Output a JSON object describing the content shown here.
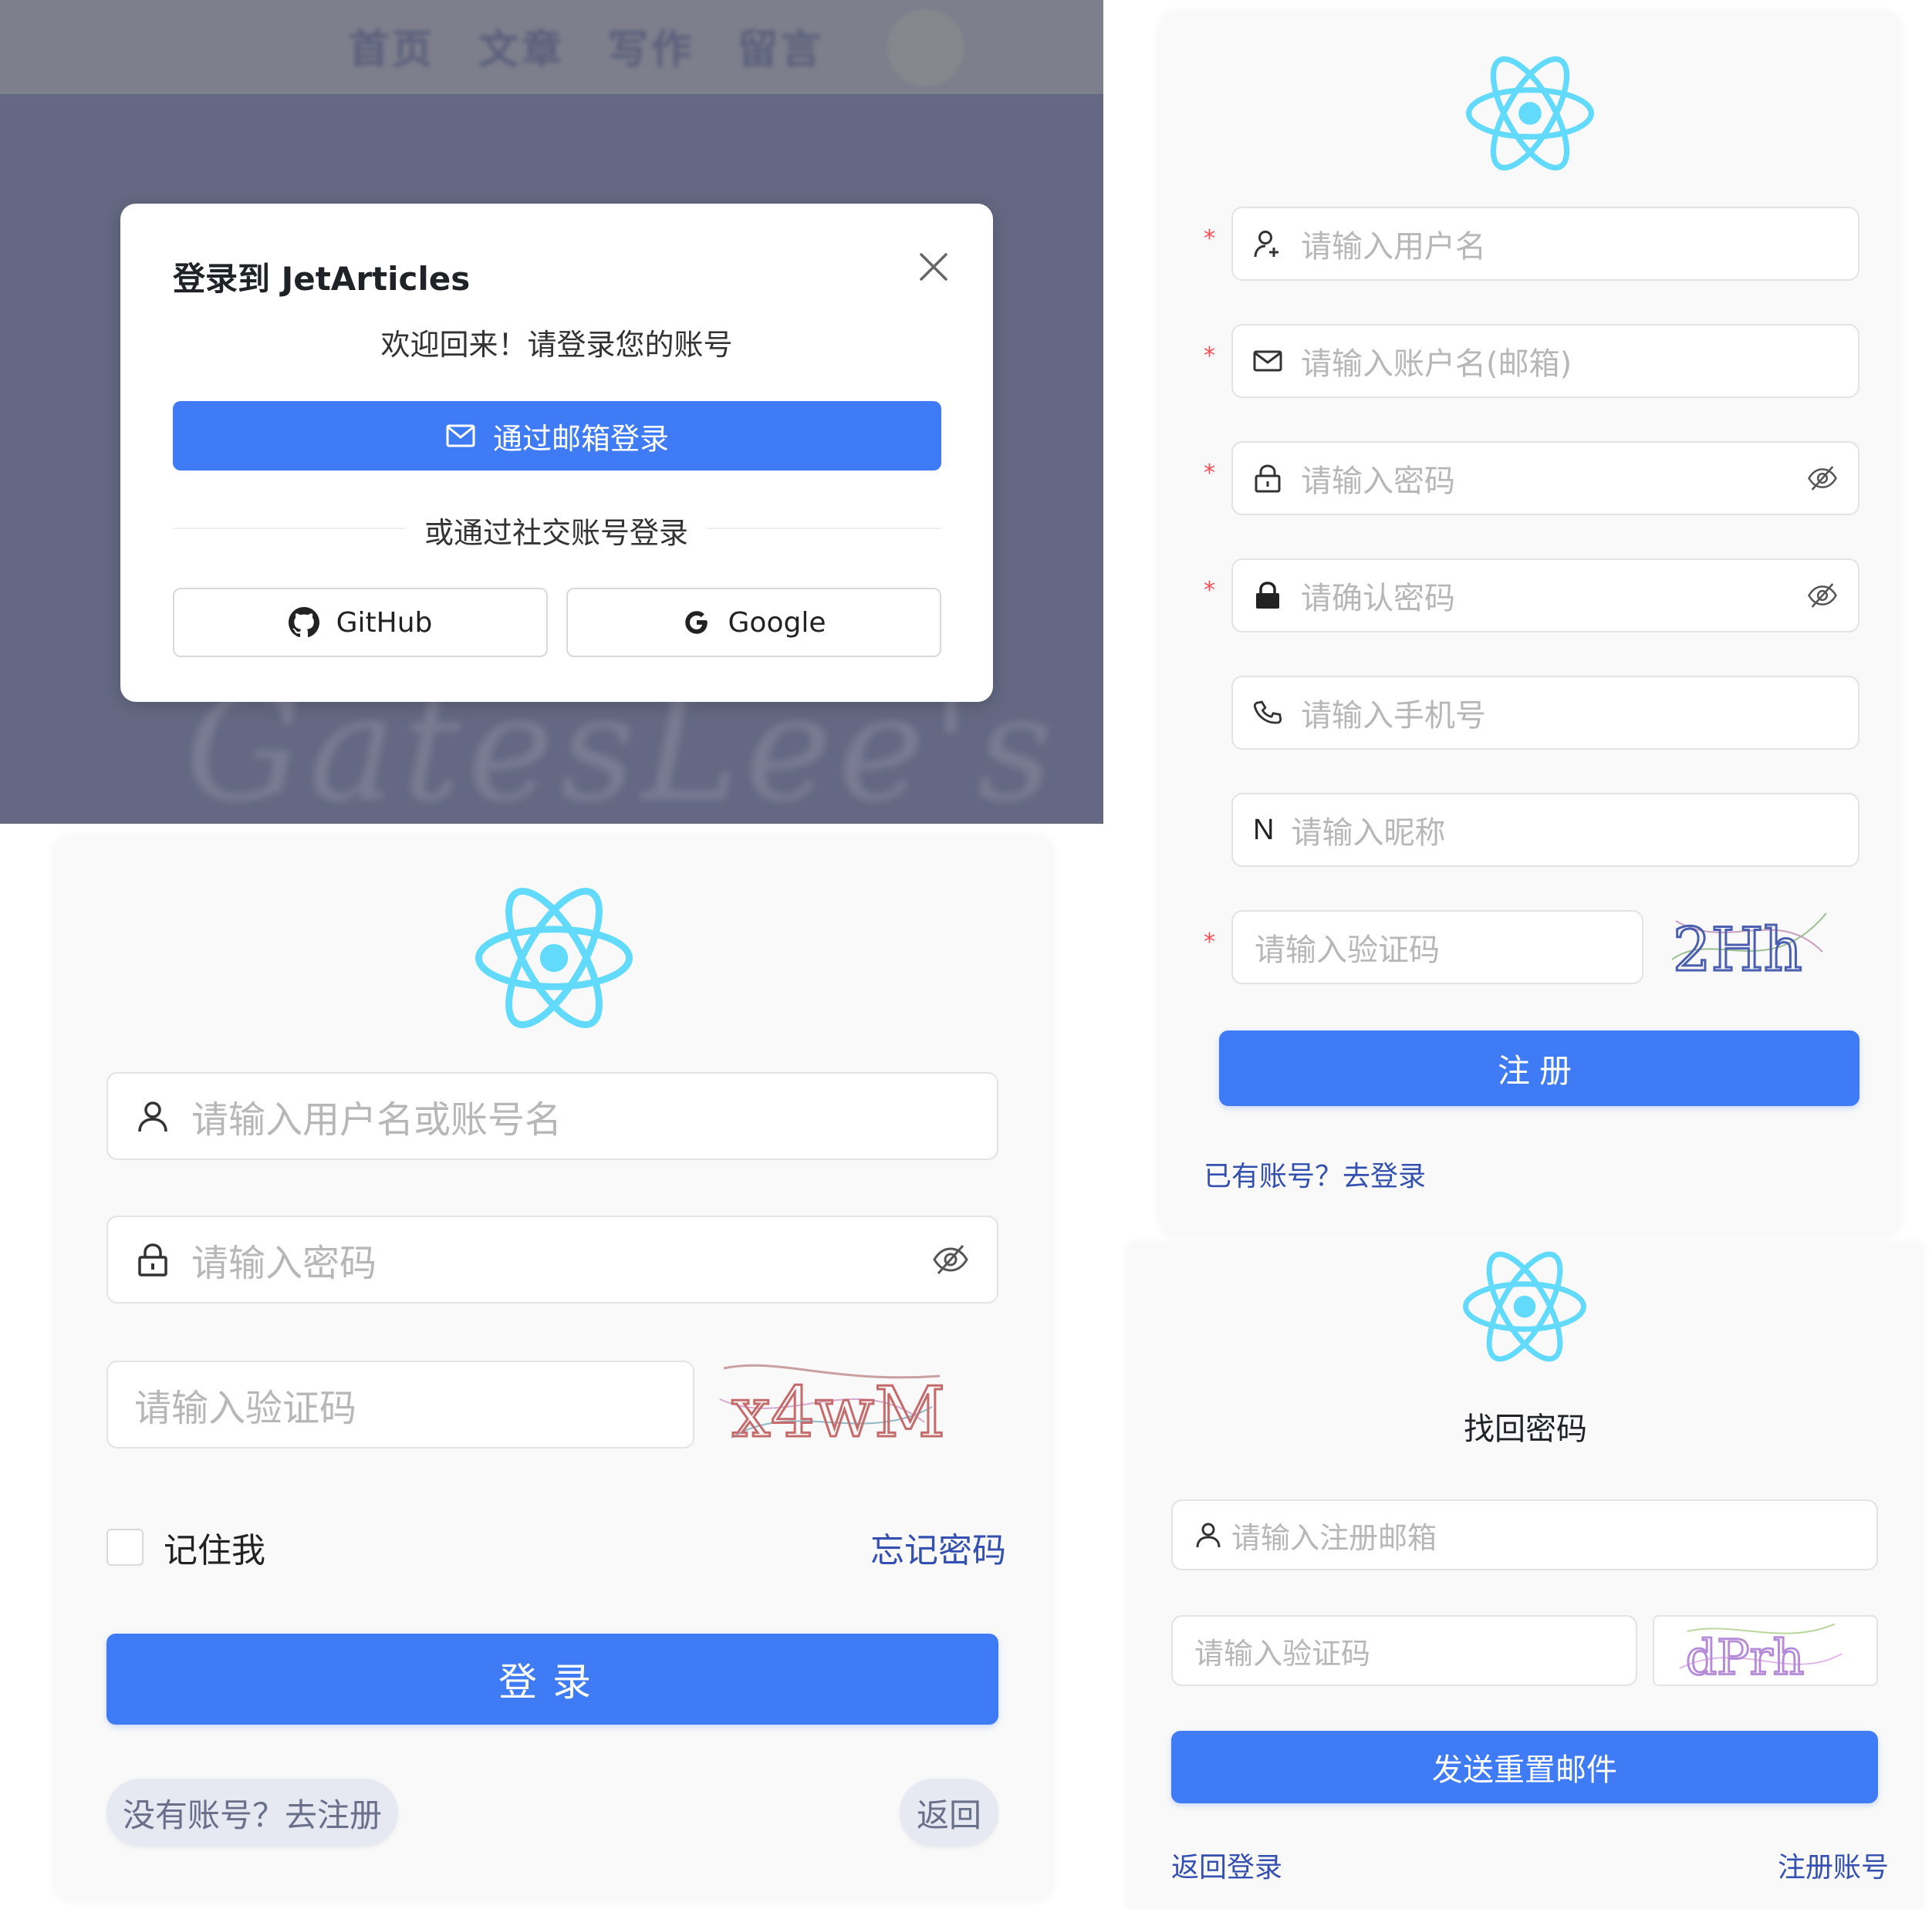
{
  "colors": {
    "primary": "#3f7bf4",
    "link": "#3450b0",
    "react_logo": "#61dafb",
    "required": "#ff4d4f",
    "placeholder": "#b7b7b7"
  },
  "login_modal": {
    "background_nav": [
      "首页",
      "文章",
      "写作",
      "留言"
    ],
    "background_brand": "GatesLee's",
    "title": "登录到 JetArticles",
    "subtitle": "欢迎回来！请登录您的账号",
    "email_button": "通过邮箱登录",
    "divider_text": "或通过社交账号登录",
    "github_button": "GitHub",
    "google_button": "Google",
    "icons": [
      "close-icon",
      "mail-icon",
      "github-icon",
      "google-icon",
      "search-icon"
    ]
  },
  "login_form": {
    "username_placeholder": "请输入用户名或账号名",
    "password_placeholder": "请输入密码",
    "captcha_placeholder": "请输入验证码",
    "captcha_text": "x4wM",
    "remember_label": "记住我",
    "forgot_link": "忘记密码",
    "login_button": "登录",
    "register_link": "没有账号？去注册",
    "back_button": "返回"
  },
  "register_form": {
    "fields": [
      {
        "name": "username",
        "placeholder": "请输入用户名",
        "required": true,
        "icon": "user-icon"
      },
      {
        "name": "email",
        "placeholder": "请输入账户名(邮箱)",
        "required": true,
        "icon": "mail-icon"
      },
      {
        "name": "password",
        "placeholder": "请输入密码",
        "required": true,
        "icon": "lock-icon"
      },
      {
        "name": "confirm",
        "placeholder": "请确认密码",
        "required": true,
        "icon": "lock-filled-icon"
      },
      {
        "name": "phone",
        "placeholder": "请输入手机号",
        "required": false,
        "icon": "phone-icon"
      },
      {
        "name": "nickname",
        "placeholder": "请输入昵称",
        "required": false,
        "icon": "N"
      }
    ],
    "captcha_placeholder": "请输入验证码",
    "captcha_text": "2Hh",
    "required_mark": "*",
    "register_button": "注册",
    "login_link": "已有账号？去登录"
  },
  "forgot_form": {
    "title": "找回密码",
    "email_placeholder": "请输入注册邮箱",
    "captcha_placeholder": "请输入验证码",
    "captcha_text": "dPrh",
    "send_button": "发送重置邮件",
    "back_link": "返回登录",
    "register_link": "注册账号"
  }
}
